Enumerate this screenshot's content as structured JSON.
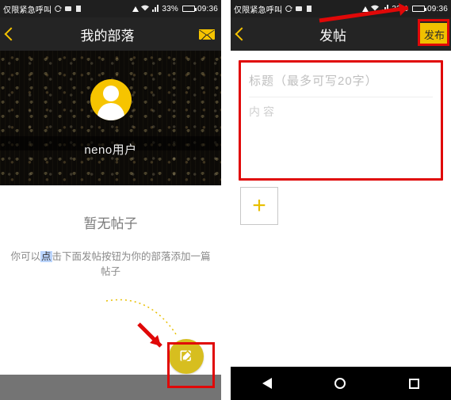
{
  "colors": {
    "accent": "#f6c400",
    "danger": "#e00808"
  },
  "statusbar": {
    "carrier": "仅限紧急呼叫",
    "battery_pct": "33%",
    "time": "09:36",
    "battery_fill": 33
  },
  "left": {
    "nav_title": "我的部落",
    "username": "neno用户",
    "empty_title": "暂无帖子",
    "empty_hint_pre": "你可以",
    "empty_hint_hl": "点",
    "empty_hint_post": "击下面发帖按钮为你的部落添加一篇帖子"
  },
  "right": {
    "nav_title": "发帖",
    "publish_label": "发布",
    "title_placeholder": "标题（最多可写20字）",
    "content_placeholder": "内容",
    "add_label": "+"
  }
}
